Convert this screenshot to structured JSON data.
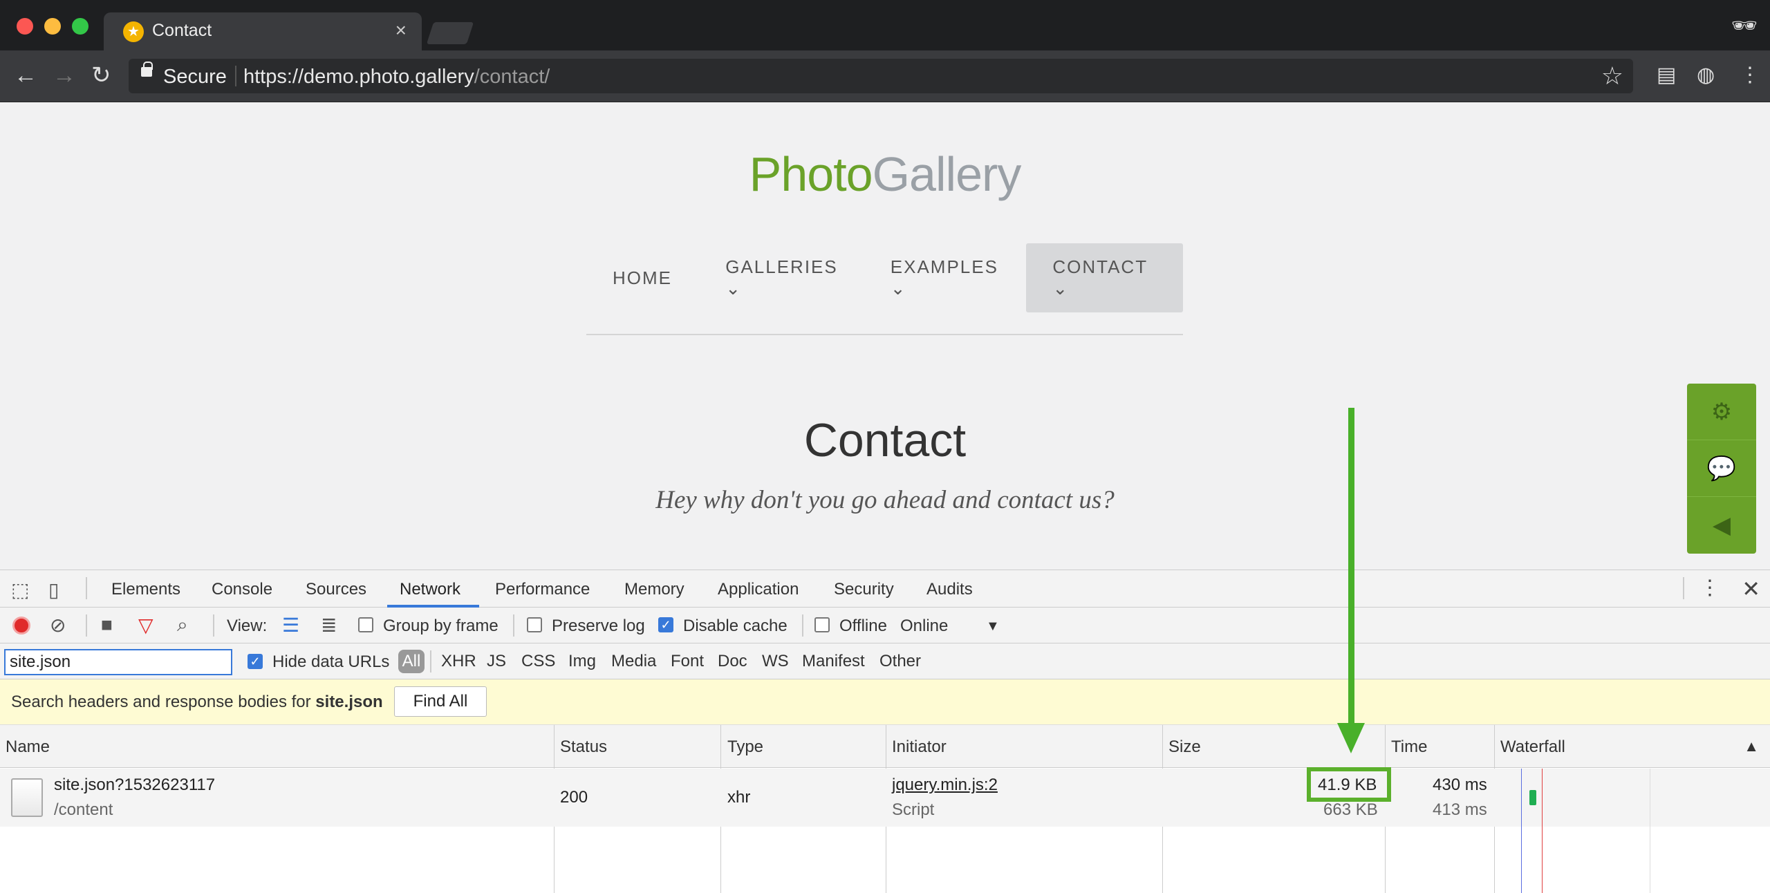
{
  "browser": {
    "tab_title": "Contact",
    "new_tab": "",
    "secure_label": "Secure",
    "url_host": "https://demo.photo.gallery",
    "url_path": "/contact/"
  },
  "site": {
    "logo_part1": "Photo",
    "logo_part2": "Gallery",
    "menu": [
      {
        "label": "HOME"
      },
      {
        "label": "GALLERIES ⌄"
      },
      {
        "label": "EXAMPLES ⌄"
      },
      {
        "label": "CONTACT ⌄"
      }
    ],
    "heading": "Contact",
    "subheading": "Hey why don't you go ahead and contact us?"
  },
  "devtools": {
    "tabs": [
      "Elements",
      "Console",
      "Sources",
      "Network",
      "Performance",
      "Memory",
      "Application",
      "Security",
      "Audits"
    ],
    "toolbar": {
      "view_label": "View:",
      "group_by_frame": "Group by frame",
      "preserve_log": "Preserve log",
      "disable_cache": "Disable cache",
      "offline": "Offline",
      "throttle": "Online"
    },
    "filter": {
      "value": "site.json",
      "hide_data_urls": "Hide data URLs",
      "types": [
        "All",
        "XHR",
        "JS",
        "CSS",
        "Img",
        "Media",
        "Font",
        "Doc",
        "WS",
        "Manifest",
        "Other"
      ]
    },
    "search_banner": {
      "prefix": "Search headers and response bodies for",
      "term": "site.json",
      "button": "Find All"
    },
    "columns": [
      "Name",
      "Status",
      "Type",
      "Initiator",
      "Size",
      "Time",
      "Waterfall"
    ],
    "row": {
      "name": "site.json?1532623117",
      "path": "/content",
      "status": "200",
      "type": "xhr",
      "initiator": "jquery.min.js:2",
      "initiator_type": "Script",
      "size": "41.9 KB",
      "content_size": "663 KB",
      "time": "430 ms",
      "latency": "413 ms"
    }
  },
  "colors": {
    "brand_green": "#6aa229",
    "annotation_green": "#49b02a",
    "devtools_accent": "#3879d9"
  }
}
